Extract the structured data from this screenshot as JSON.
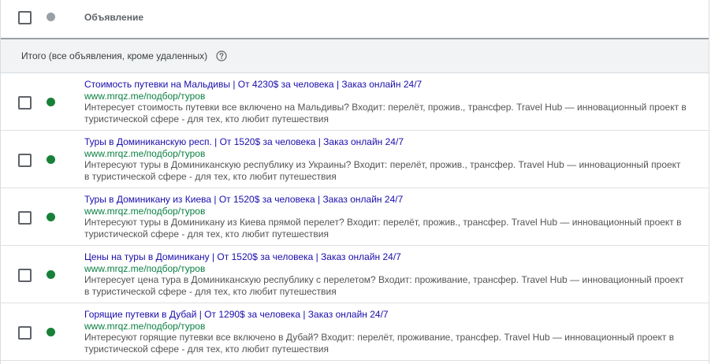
{
  "header": {
    "column_title": "Объявление",
    "status_dot_color": "#9aa0a6"
  },
  "total": {
    "label": "Итого (все объявления, кроме удаленных)",
    "help_icon": "help-circle-icon"
  },
  "status_color": "#188038",
  "ads": [
    {
      "headline": "Стоимость путевки на Мальдивы | От 4230$ за человека | Заказ онлайн 24/7",
      "url": "www.mrqz.me/подбор/туров",
      "description": "Интересует стоимость путевки все включено на Мальдивы? Входит: перелёт, прожив., трансфер. Travel Hub — инновационный проект в туристической сфере - для тех, кто любит путешествия"
    },
    {
      "headline": "Туры в Доминиканскую респ. | От 1520$ за человека | Заказ онлайн 24/7",
      "url": "www.mrqz.me/подбор/туров",
      "description": "Интересуют туры в Доминиканскую республику из Украины? Входит: перелёт, прожив., трансфер. Travel Hub — инновационный проект в туристической сфере - для тех, кто любит путешествия"
    },
    {
      "headline": "Туры в Доминикану из Киева | От 1520$ за человека | Заказ онлайн 24/7",
      "url": "www.mrqz.me/подбор/туров",
      "description": "Интересуют туры в Доминикану из Киева прямой перелет? Входит: перелёт, прожив., трансфер. Travel Hub — инновационный проект в туристической сфере - для тех, кто любит путешествия"
    },
    {
      "headline": "Цены на туры в Доминикану | От 1520$ за человека | Заказ онлайн 24/7",
      "url": "www.mrqz.me/подбор/туров",
      "description": "Интересует цена тура в Доминиканскую республику с перелетом? Входит: проживание, трансфер. Travel Hub — инновационный проект в туристической сфере - для тех, кто любит путешествия"
    },
    {
      "headline": "Горящие путевки в Дубай | От 1290$ за человека | Заказ онлайн 24/7",
      "url": "www.mrqz.me/подбор/туров",
      "description": "Интересуют горящие путевки все включено в Дубай? Входит: перелёт, проживание, трансфер. Travel Hub — инновационный проект в туристической сфере - для тех, кто любит путешествия"
    }
  ]
}
